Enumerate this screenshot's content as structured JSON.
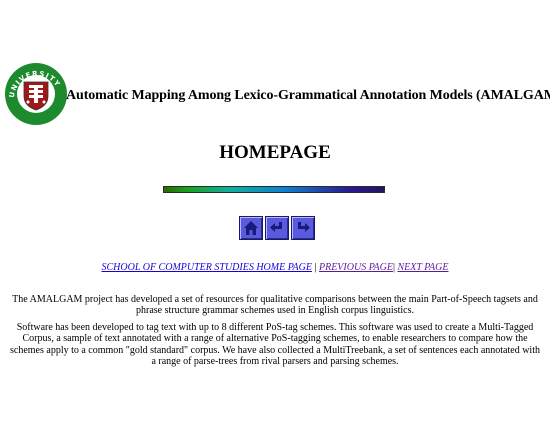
{
  "header": {
    "logo_text": "UNIVERSITY OF LEEDS",
    "title": "Automatic Mapping Among Lexico-Grammatical Annotation Models (AMALGAM)"
  },
  "page_heading": "HOMEPAGE",
  "nav_icons": [
    {
      "icon": "home-icon"
    },
    {
      "icon": "back-arrow-icon"
    },
    {
      "icon": "forward-arrow-icon"
    }
  ],
  "links": {
    "school": "SCHOOL OF COMPUTER STUDIES HOME PAGE",
    "sep1": " | ",
    "previous": "PREVIOUS PAGE",
    "sep2": "| ",
    "next": "NEXT PAGE"
  },
  "body": {
    "paragraph1": "The AMALGAM project has developed a set of resources for qualitative comparisons between the main Part-of-Speech tagsets and phrase structure grammar schemes used in English corpus linguistics.",
    "paragraph2": "Software has been developed to tag text with up to 8 different PoS-tag schemes. This software was used to create a Multi-Tagged Corpus, a sample of text annotated with a range of alternative PoS-tagging schemes, to enable researchers to compare how the schemes apply to a common \"gold standard\" corpus. We have also collected a MultiTreebank, a set of sentences each annotated with a range of parse-trees from rival parsers and parsing schemes."
  },
  "colors": {
    "link": "#1a00d8",
    "visited_link": "#5a1a9a",
    "logo_green": "#1e8a2e",
    "logo_red": "#a01818",
    "button_blue": "#5a5adf"
  }
}
